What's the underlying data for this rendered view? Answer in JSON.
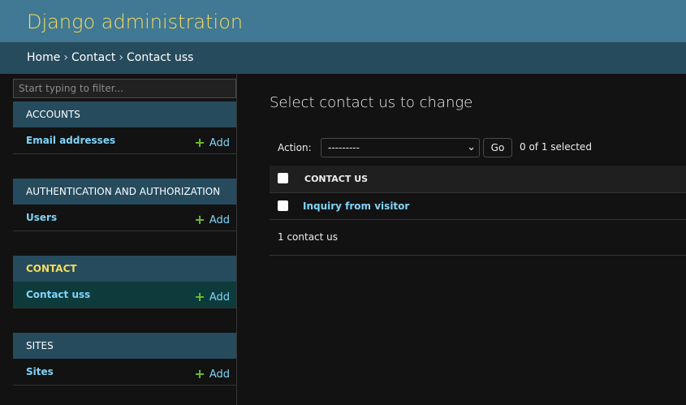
{
  "header": {
    "site_name": "Django administration"
  },
  "breadcrumbs": {
    "items": [
      "Home",
      "Contact",
      "Contact uss"
    ],
    "separator": "›"
  },
  "sidebar": {
    "filter_placeholder": "Start typing to filter...",
    "add_label": "Add",
    "modules": [
      {
        "caption": "Accounts",
        "models": [
          {
            "label": "Email addresses"
          }
        ]
      },
      {
        "caption": "Authentication and Authorization",
        "models": [
          {
            "label": "Users"
          }
        ]
      },
      {
        "caption": "Contact",
        "current": true,
        "models": [
          {
            "label": "Contact uss",
            "current": true
          }
        ]
      },
      {
        "caption": "Sites",
        "models": [
          {
            "label": "Sites"
          }
        ]
      }
    ]
  },
  "main": {
    "title": "Select contact us to change",
    "actions": {
      "label": "Action:",
      "selected_option": "---------",
      "go_label": "Go",
      "selected_count": "0 of 1 selected"
    },
    "table": {
      "column_header": "Contact us",
      "rows": [
        {
          "label": "Inquiry from visitor"
        }
      ]
    },
    "paginator": "1 contact us"
  },
  "colors": {
    "header_bg": "#417893",
    "breadcrumbs_bg": "#264b5d",
    "site_name": "#f5dd5d",
    "link": "#81d4fa",
    "add_plus": "#70bf2b",
    "current_row_bg": "#0d3a3b",
    "page_bg": "#121212"
  },
  "icons": {
    "add": "plus-icon",
    "select": "chevron-down-icon"
  }
}
